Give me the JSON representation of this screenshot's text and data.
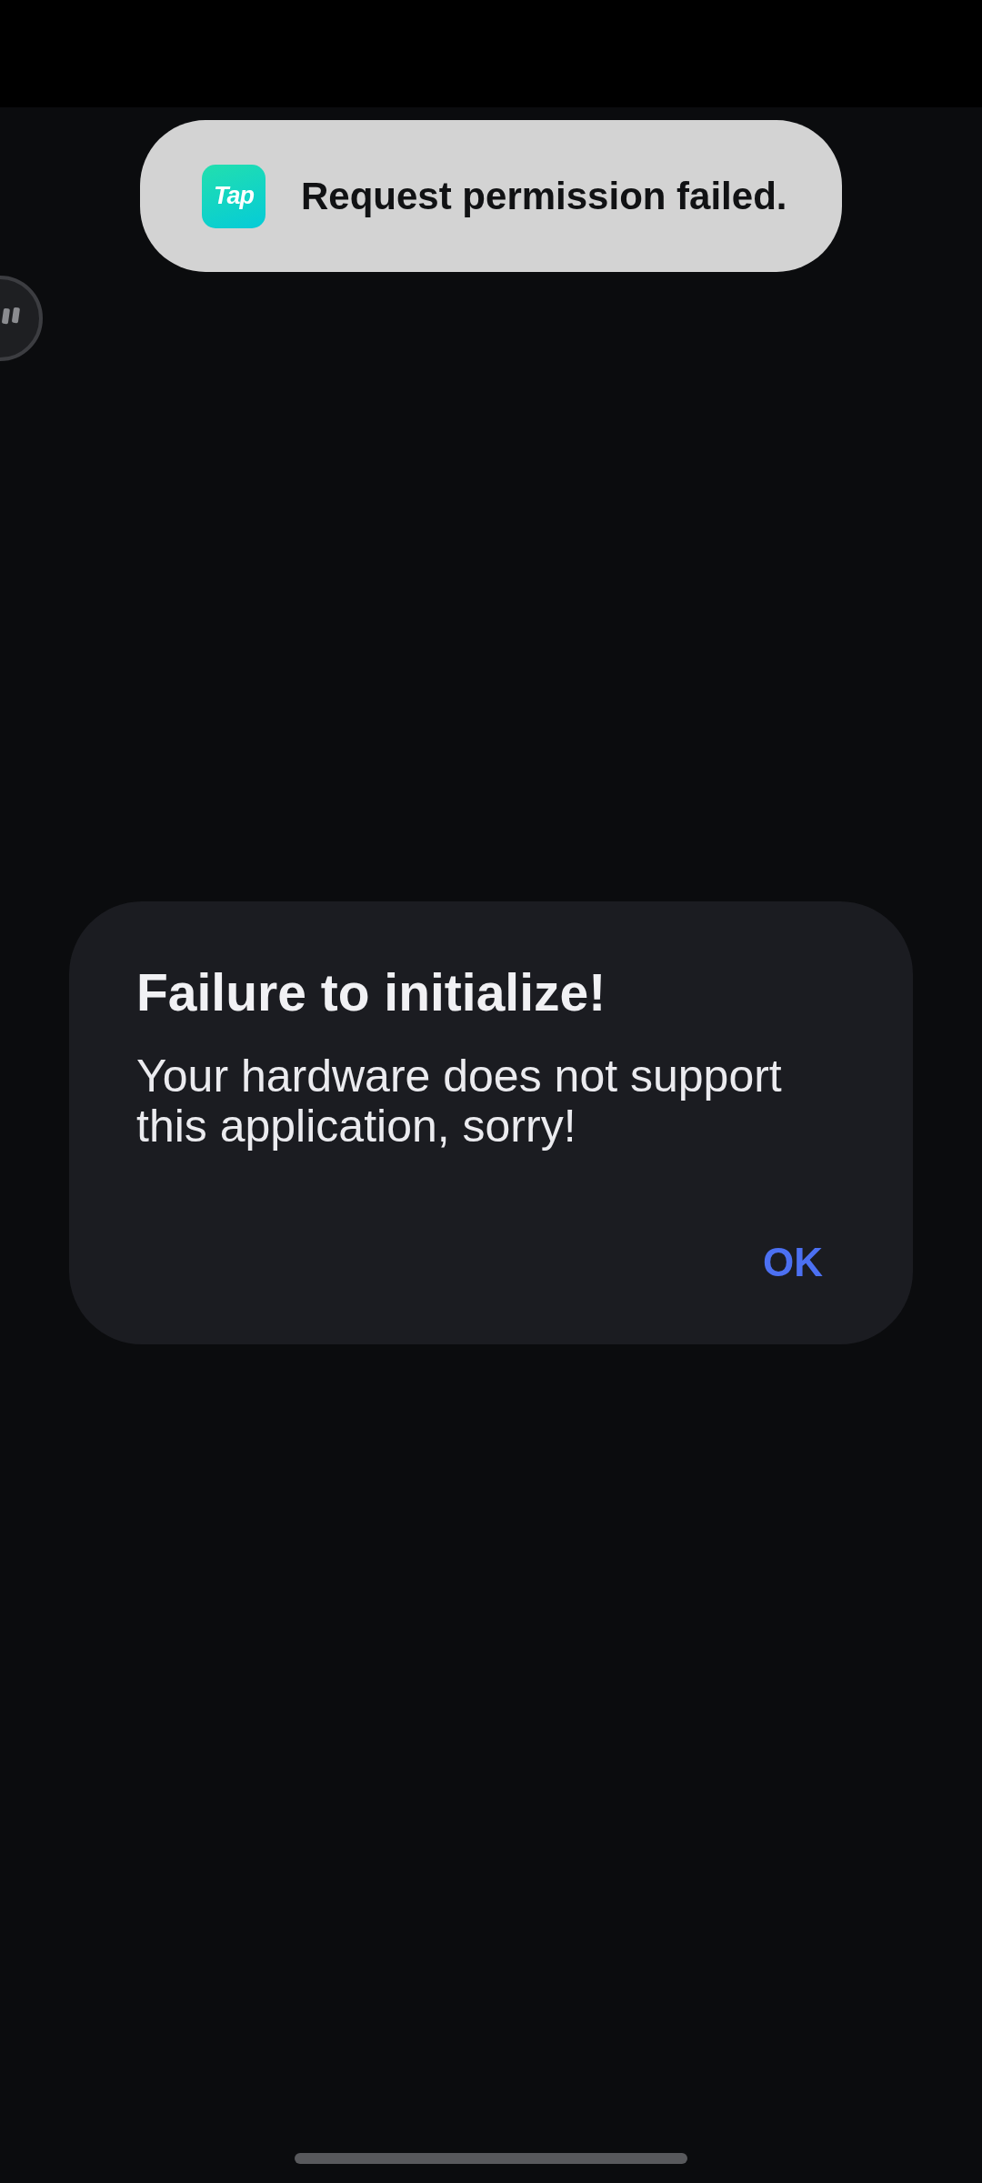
{
  "toast": {
    "logo": "Tap",
    "message": "Request permission failed."
  },
  "dialog": {
    "title": "Failure to initialize!",
    "message": "Your hardware does not support this application, sorry!",
    "buttons": [
      {
        "label": "OK"
      }
    ]
  }
}
